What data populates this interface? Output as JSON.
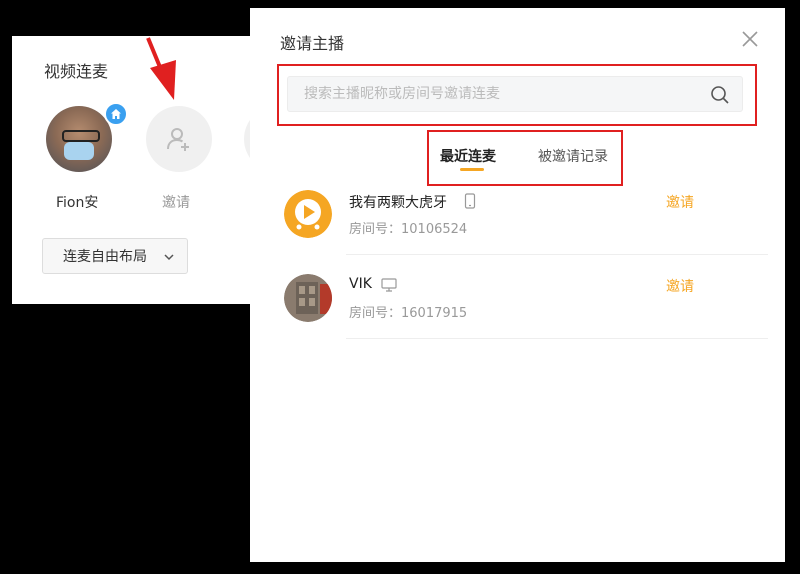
{
  "left_panel": {
    "title": "视频连麦",
    "host_name": "Fion安",
    "invite_label": "邀请",
    "layout_select": "连麦自由布局"
  },
  "modal": {
    "title": "邀请主播",
    "search": {
      "placeholder": "搜索主播昵称或房间号邀请连麦",
      "value": ""
    },
    "tabs": [
      {
        "label": "最近连麦",
        "active": true
      },
      {
        "label": "被邀请记录",
        "active": false
      }
    ],
    "list": [
      {
        "name": "我有两颗大虎牙",
        "device_icon": "mobile-icon",
        "room": "房间号：10106524",
        "action": "邀请"
      },
      {
        "name": "VIK",
        "device_icon": "monitor-icon",
        "room": "房间号：16017915",
        "action": "邀请"
      }
    ]
  },
  "colors": {
    "accent": "#f5a623",
    "highlight": "#e02020",
    "badge": "#3aa0f0"
  }
}
